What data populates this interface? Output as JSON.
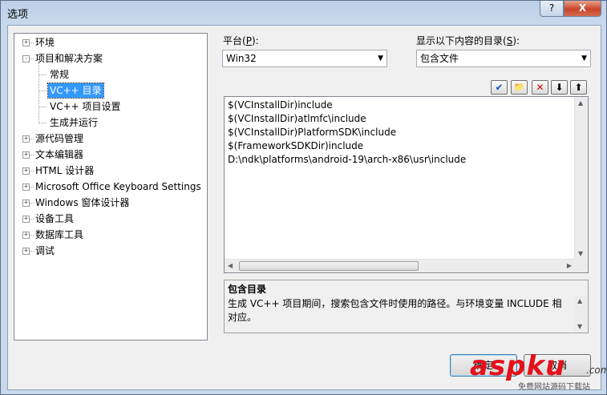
{
  "window": {
    "title": "选项",
    "help": "?",
    "close": "X"
  },
  "tree": {
    "items": [
      {
        "label": "环境",
        "level": 0,
        "expander": "+"
      },
      {
        "label": "项目和解决方案",
        "level": 0,
        "expander": "-"
      },
      {
        "label": "常规",
        "level": 1
      },
      {
        "label": "VC++ 目录",
        "level": 1,
        "selected": true
      },
      {
        "label": "VC++ 项目设置",
        "level": 1
      },
      {
        "label": "生成并运行",
        "level": 1
      },
      {
        "label": "源代码管理",
        "level": 0,
        "expander": "+"
      },
      {
        "label": "文本编辑器",
        "level": 0,
        "expander": "+"
      },
      {
        "label": "HTML 设计器",
        "level": 0,
        "expander": "+"
      },
      {
        "label": "Microsoft Office Keyboard Settings",
        "level": 0,
        "expander": "+"
      },
      {
        "label": "Windows 窗体设计器",
        "level": 0,
        "expander": "+"
      },
      {
        "label": "设备工具",
        "level": 0,
        "expander": "+"
      },
      {
        "label": "数据库工具",
        "level": 0,
        "expander": "+"
      },
      {
        "label": "调试",
        "level": 0,
        "expander": "+"
      }
    ]
  },
  "platform": {
    "label_prefix": "平台(",
    "hotkey": "P",
    "label_suffix": "):",
    "value": "Win32"
  },
  "show_dirs": {
    "label_prefix": "显示以下内容的目录(",
    "hotkey": "S",
    "label_suffix": "):",
    "value": "包含文件"
  },
  "toolbar": {
    "check": "✔",
    "folder": "📁",
    "delete": "✕",
    "down": "⬇",
    "up": "⬆"
  },
  "directories": [
    "$(VCInstallDir)include",
    "$(VCInstallDir)atlmfc\\include",
    "$(VCInstallDir)PlatformSDK\\include",
    "$(FrameworkSDKDir)include",
    "D:\\ndk\\platforms\\android-19\\arch-x86\\usr\\include"
  ],
  "description": {
    "title": "包含目录",
    "text": "生成 VC++ 项目期间，搜索包含文件时使用的路径。与环境变量 INCLUDE 相对应。"
  },
  "buttons": {
    "ok": "确定",
    "cancel": "取消"
  },
  "watermark": {
    "brand": "aspku",
    "tld": ".com",
    "subtitle": "免费网站源码下载站"
  }
}
